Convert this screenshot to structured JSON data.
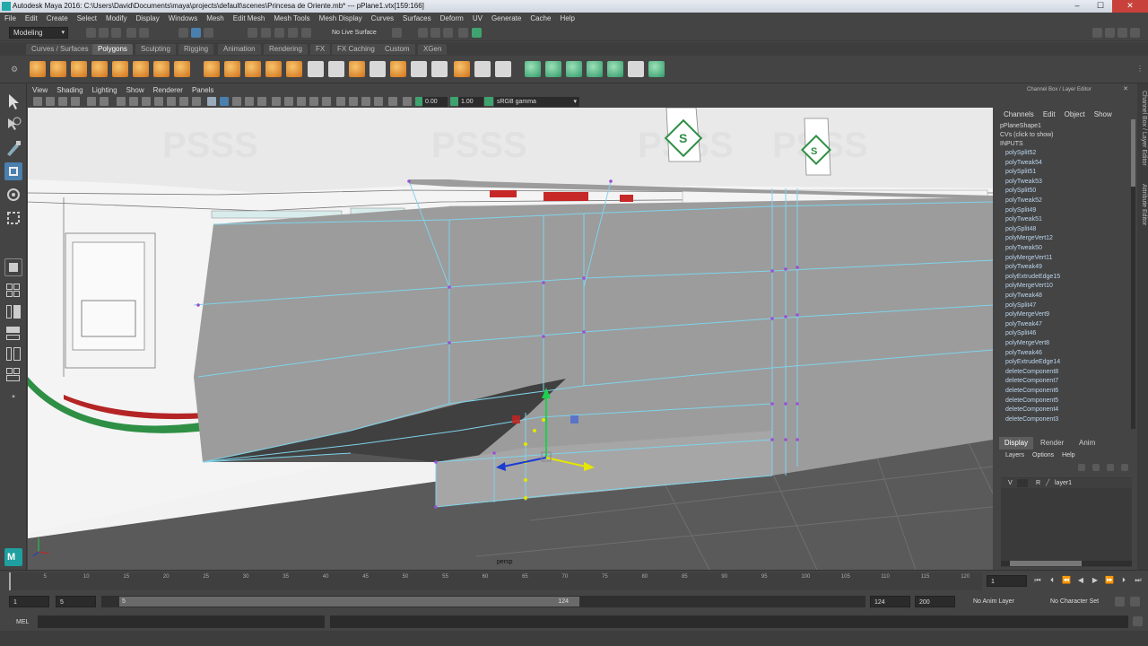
{
  "window": {
    "title": "Autodesk Maya 2016: C:\\Users\\David\\Documents\\maya\\projects\\default\\scenes\\Princesa de Oriente.mb*   ---   pPlane1.vtx[159:166]"
  },
  "menubar": [
    "File",
    "Edit",
    "Create",
    "Select",
    "Modify",
    "Display",
    "Windows",
    "Mesh",
    "Edit Mesh",
    "Mesh Tools",
    "Mesh Display",
    "Curves",
    "Surfaces",
    "Deform",
    "UV",
    "Generate",
    "Cache",
    "Help"
  ],
  "statusline": {
    "menuset": "Modeling",
    "live_surface": "No Live Surface"
  },
  "shelf_tabs": [
    "Curves / Surfaces",
    "Polygons",
    "Sculpting",
    "Rigging",
    "Animation",
    "Rendering",
    "FX",
    "FX Caching",
    "Custom",
    "XGen"
  ],
  "shelf_active_tab": "Polygons",
  "viewport": {
    "menu": [
      "View",
      "Shading",
      "Lighting",
      "Show",
      "Renderer",
      "Panels"
    ],
    "near_value": "0.00",
    "far_value": "1.00",
    "color_space": "sRGB gamma",
    "camera_label": "persp",
    "watermark": "PSSS"
  },
  "channelbox": {
    "header": "Channel Box / Layer Editor",
    "menu": [
      "Channels",
      "Edit",
      "Object",
      "Show"
    ],
    "shape_name": "pPlaneShape1",
    "cvs_label": "CVs (click to show)",
    "inputs_label": "INPUTS",
    "inputs": [
      "polySplit52",
      "polyTweak54",
      "polySplit51",
      "polyTweak53",
      "polySplit50",
      "polyTweak52",
      "polySplit49",
      "polyTweak51",
      "polySplit48",
      "polyMergeVert12",
      "polyTweak50",
      "polyMergeVert11",
      "polyTweak49",
      "polyExtrudeEdge15",
      "polyMergeVert10",
      "polyTweak48",
      "polySplit47",
      "polyMergeVert9",
      "polyTweak47",
      "polySplit46",
      "polyMergeVert8",
      "polyTweak46",
      "polyExtrudeEdge14",
      "deleteComponent8",
      "deleteComponent7",
      "deleteComponent6",
      "deleteComponent5",
      "deleteComponent4",
      "deleteComponent3"
    ]
  },
  "layereditor": {
    "tabs": [
      "Display",
      "Render",
      "Anim"
    ],
    "active_tab": "Display",
    "menu": [
      "Layers",
      "Options",
      "Help"
    ],
    "layer": {
      "visible": "V",
      "render": "R",
      "name": "layer1"
    }
  },
  "sidetabs": [
    "Channel Box / Layer Editor",
    "Attribute Editor"
  ],
  "timeslider": {
    "ticks": [
      "5",
      "10",
      "15",
      "20",
      "25",
      "30",
      "35",
      "40",
      "45",
      "50",
      "55",
      "60",
      "65",
      "70",
      "75",
      "80",
      "85",
      "90",
      "95",
      "100",
      "105",
      "110",
      "115",
      "120"
    ],
    "current_frame": "1"
  },
  "rangeslider": {
    "start": "1",
    "range_start": "5",
    "range_start_inner": "5",
    "range_end_inner": "124",
    "range_end": "124",
    "end": "200",
    "anim_layer": "No Anim Layer",
    "character_set": "No Character Set"
  },
  "cmdline": {
    "label": "MEL"
  },
  "colors": {
    "wire": "#7fd3ea",
    "vertex": "#9a4fd6",
    "ui_bg": "#444444",
    "grid_floor": "#5a5a5a",
    "hull_grey": "#9a9a9a",
    "stripe_green": "#2f8f45",
    "stripe_red": "#b52424"
  }
}
